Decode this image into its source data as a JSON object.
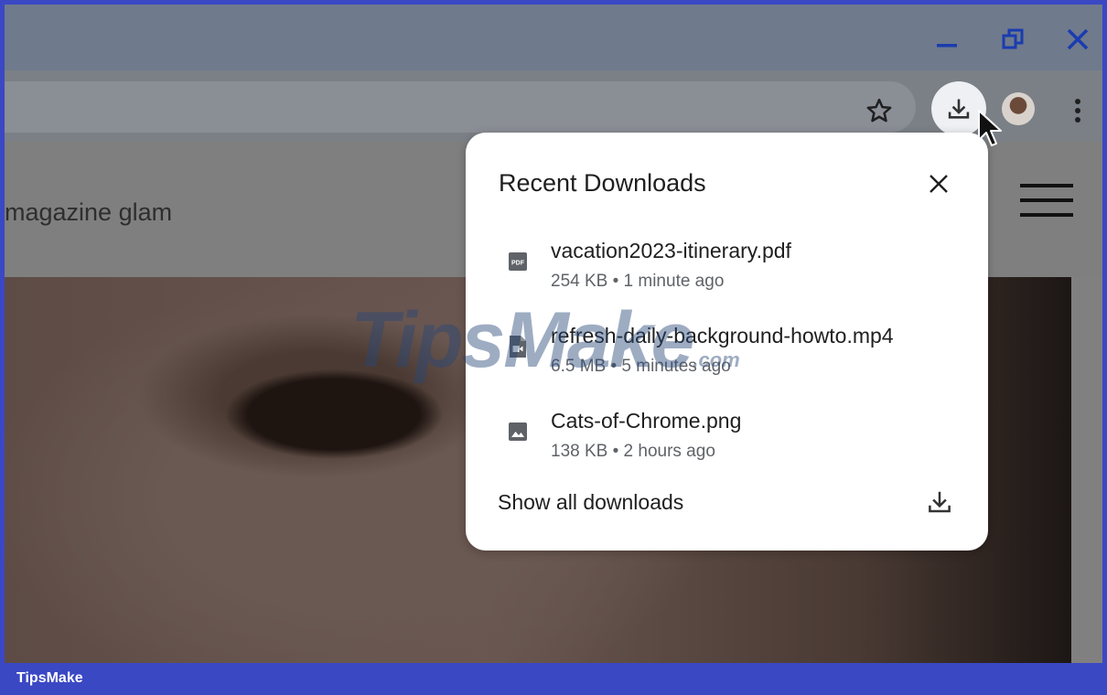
{
  "window": {
    "controls": [
      "minimize-icon",
      "restore-icon",
      "close-icon"
    ]
  },
  "toolbar": {
    "icons": [
      "star-icon",
      "download-icon",
      "avatar",
      "more-vert-icon"
    ]
  },
  "page": {
    "site_title": "magazine glam"
  },
  "downloads": {
    "title": "Recent Downloads",
    "items": [
      {
        "name": "vacation2023-itinerary.pdf",
        "meta": "254 KB • 1 minute ago",
        "icon": "pdf-file-icon"
      },
      {
        "name": "refresh-daily-background-howto.mp4",
        "meta": "6.5 MB • 5 minutes ago",
        "icon": "video-file-icon"
      },
      {
        "name": "Cats-of-Chrome.png",
        "meta": "138 KB • 2 hours ago",
        "icon": "image-file-icon"
      }
    ],
    "show_all_label": "Show all downloads"
  },
  "watermark": {
    "text": "TipsMake",
    "suffix": ".com"
  },
  "footer": {
    "brand": "TipsMake"
  },
  "colors": {
    "border": "#3b48c4",
    "popup_bg": "#ffffff",
    "text_primary": "#1f1f1f",
    "text_secondary": "#5f6368"
  }
}
